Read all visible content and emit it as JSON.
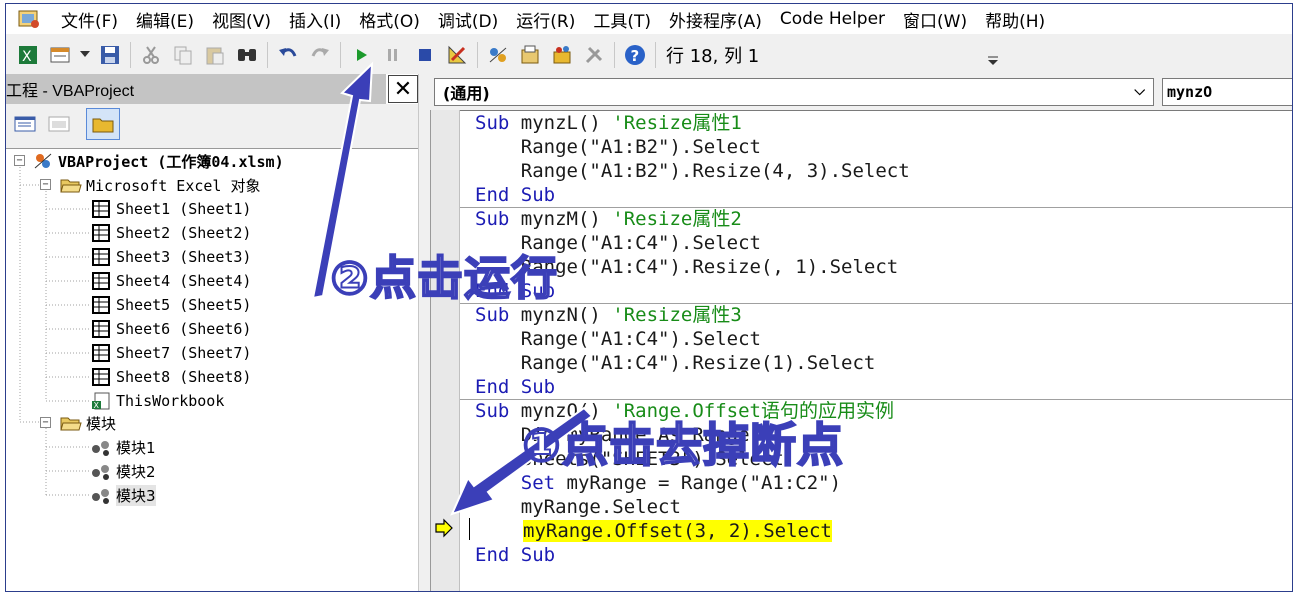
{
  "menu": {
    "items": [
      {
        "label": "文件(F)"
      },
      {
        "label": "编辑(E)"
      },
      {
        "label": "视图(V)"
      },
      {
        "label": "插入(I)"
      },
      {
        "label": "格式(O)"
      },
      {
        "label": "调试(D)"
      },
      {
        "label": "运行(R)"
      },
      {
        "label": "工具(T)"
      },
      {
        "label": "外接程序(A)"
      },
      {
        "label": "Code Helper"
      },
      {
        "label": "窗口(W)"
      },
      {
        "label": "帮助(H)"
      }
    ]
  },
  "toolbar": {
    "position_readout": "行 18, 列 1",
    "icons": [
      "view-excel-icon",
      "insert-module-icon",
      "save-icon",
      "cut-icon",
      "copy-icon",
      "paste-icon",
      "find-icon",
      "undo-icon",
      "redo-icon",
      "run-icon",
      "break-icon",
      "reset-icon",
      "design-mode-icon",
      "project-explorer-icon",
      "properties-icon",
      "object-browser-icon",
      "toolbox-icon",
      "help-icon"
    ]
  },
  "project": {
    "title": "工程 - VBAProject",
    "close_glyph": "✕",
    "tree": {
      "root": "VBAProject (工作簿04.xlsm)",
      "excel_objects_folder": "Microsoft Excel 对象",
      "sheets": [
        "Sheet1 (Sheet1)",
        "Sheet2 (Sheet2)",
        "Sheet3 (Sheet3)",
        "Sheet4 (Sheet4)",
        "Sheet5 (Sheet5)",
        "Sheet6 (Sheet6)",
        "Sheet7 (Sheet7)",
        "Sheet8 (Sheet8)"
      ],
      "workbook": "ThisWorkbook",
      "modules_folder": "模块",
      "modules": [
        "模块1",
        "模块2",
        "模块3"
      ]
    }
  },
  "code_window": {
    "object_combo": "(通用)",
    "procedure_combo": "mynzO",
    "lines": {
      "l1_kw": "Sub",
      "l1_name": " mynzL() ",
      "l1_cm": "'Resize属性1",
      "l2": "    Range(\"A1:B2\").Select",
      "l3": "    Range(\"A1:B2\").Resize(4, 3).Select",
      "l4": "End Sub",
      "l5_kw": "Sub",
      "l5_name": " mynzM() ",
      "l5_cm": "'Resize属性2",
      "l6": "    Range(\"A1:C4\").Select",
      "l7": "    Range(\"A1:C4\").Resize(, 1).Select",
      "l8": "End Sub",
      "l9_kw": "Sub",
      "l9_name": " mynzN() ",
      "l9_cm": "'Resize属性3",
      "l10": "    Range(\"A1:C4\").Select",
      "l11": "    Range(\"A1:C4\").Resize(1).Select",
      "l12": "End Sub",
      "l13_kw": "Sub",
      "l13_name": " mynzO() ",
      "l13_cm": "'Range.Offset语句的应用实例",
      "l14": "    Dim myRange As Range",
      "l15": "    Sheets(\"SHEET3\").Select",
      "l16_kw": "    Set",
      "l16_rest": " myRange = Range(\"A1:C2\")",
      "l17": "    myRange.Select",
      "l18": "myRange.Offset(3, 2).Select",
      "l19": "End Sub"
    }
  },
  "annotations": {
    "run_label": "②点击运行",
    "breakpoint_label": "①点击去掉断点",
    "color": "#3b3fb8"
  }
}
